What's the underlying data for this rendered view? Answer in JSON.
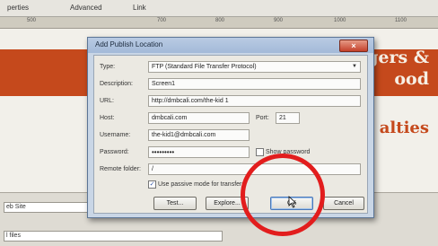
{
  "background_app": {
    "tabs": [
      "perties",
      "Advanced",
      "Link"
    ],
    "ruler_ticks": [
      "500",
      "700",
      "800",
      "900",
      "1000",
      "1100"
    ],
    "orange_text_1": "gers &",
    "orange_text_2": "ood",
    "big_word": "alties",
    "left_text": "eb Site",
    "left_text_2": "l files"
  },
  "dialog": {
    "title": "Add Publish Location",
    "close_symbol": "×",
    "type_label": "Type:",
    "type_value": "FTP (Standard File Transfer Protocol)",
    "description_label": "Description:",
    "description_value": "Screen1",
    "url_label": "URL:",
    "url_value": "http://dmbcali.com/the-kid 1",
    "host_label": "Host:",
    "host_value": "dmbcali.com",
    "port_label": "Port:",
    "port_value": "21",
    "username_label": "Username:",
    "username_value": "the-kid1@dmbcali.com",
    "password_label": "Password:",
    "password_value": "•••••••••",
    "show_password_label": "Show password",
    "remote_folder_label": "Remote folder:",
    "remote_folder_value": "/",
    "passive_mode_label": "Use passive mode for transfers",
    "passive_mode_checked": "✓",
    "test_button": "Test...",
    "explore_button": "Explore...",
    "ok_button": "OK",
    "cancel_button": "Cancel"
  },
  "colors": {
    "annotation": "#e21d1d",
    "accent_orange": "#c5491c"
  }
}
